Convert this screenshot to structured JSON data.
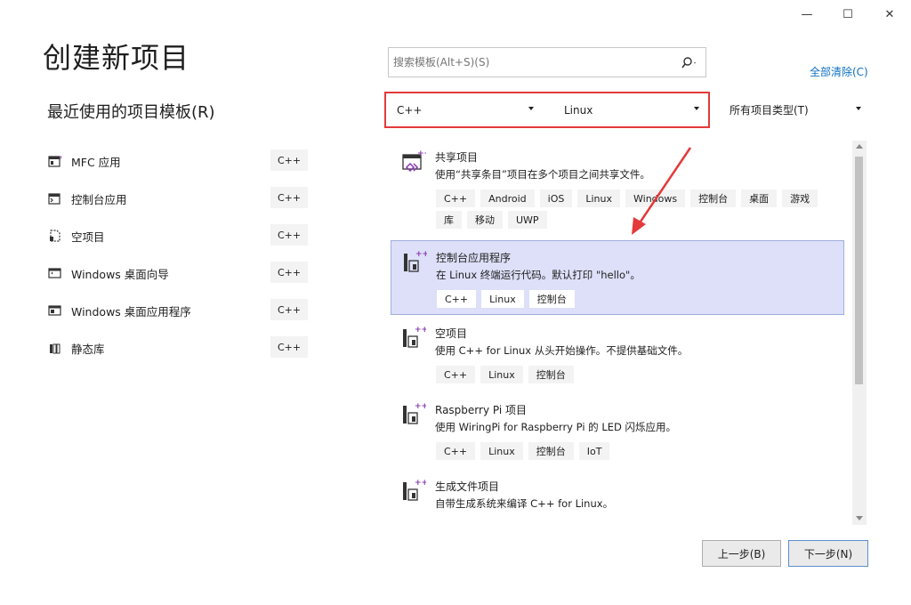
{
  "window": {
    "minimize": "—",
    "maximize": "☐",
    "close": "✕"
  },
  "page_title": "创建新项目",
  "recent": {
    "title": "最近使用的项目模板(R)",
    "items": [
      {
        "label": "MFC 应用",
        "lang": "C++",
        "icon": "mfc-icon"
      },
      {
        "label": "控制台应用",
        "lang": "C++",
        "icon": "console-icon"
      },
      {
        "label": "空项目",
        "lang": "C++",
        "icon": "empty-project-icon"
      },
      {
        "label": "Windows 桌面向导",
        "lang": "C++",
        "icon": "desktop-wizard-icon"
      },
      {
        "label": "Windows 桌面应用程序",
        "lang": "C++",
        "icon": "desktop-app-icon"
      },
      {
        "label": "静态库",
        "lang": "C++",
        "icon": "static-lib-icon"
      }
    ]
  },
  "search": {
    "placeholder": "搜索模板(Alt+S)(S)",
    "value": ""
  },
  "clear_all": "全部清除(C)",
  "filters": {
    "language": "C++",
    "platform": "Linux",
    "project_type": "所有项目类型(T)"
  },
  "templates": [
    {
      "name": "共享项目",
      "desc": "使用“共享条目”项目在多个项目之间共享文件。",
      "tags": [
        "C++",
        "Android",
        "iOS",
        "Linux",
        "Windows",
        "控制台",
        "桌面",
        "游戏",
        "库",
        "移动",
        "UWP"
      ],
      "selected": false
    },
    {
      "name": "控制台应用程序",
      "desc": "在 Linux 终端运行代码。默认打印 \"hello\"。",
      "tags": [
        "C++",
        "Linux",
        "控制台"
      ],
      "selected": true
    },
    {
      "name": "空项目",
      "desc": "使用 C++ for Linux 从头开始操作。不提供基础文件。",
      "tags": [
        "C++",
        "Linux",
        "控制台"
      ],
      "selected": false
    },
    {
      "name": "Raspberry Pi 项目",
      "desc": "使用 WiringPi for Raspberry Pi 的 LED 闪烁应用。",
      "tags": [
        "C++",
        "Linux",
        "控制台",
        "IoT"
      ],
      "selected": false
    },
    {
      "name": "生成文件项目",
      "desc": "自带生成系统来编译 C++ for Linux。",
      "tags": [],
      "selected": false
    }
  ],
  "buttons": {
    "back": "上一步(B)",
    "next": "下一步(N)"
  },
  "colors": {
    "highlight_border": "#e33a3a",
    "selection_bg": "#dde0f8",
    "link": "#0e70c0",
    "accent_icon": "#8a3ab0"
  }
}
